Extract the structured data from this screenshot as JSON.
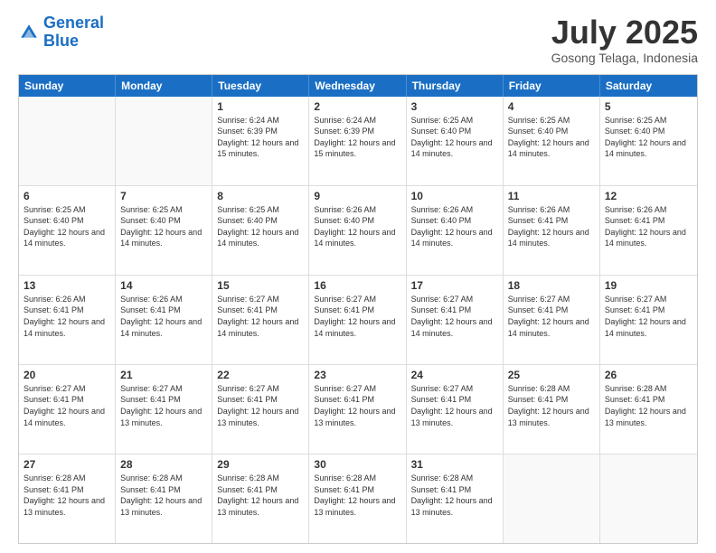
{
  "logo": {
    "text_general": "General",
    "text_blue": "Blue"
  },
  "title": "July 2025",
  "location": "Gosong Telaga, Indonesia",
  "header_days": [
    "Sunday",
    "Monday",
    "Tuesday",
    "Wednesday",
    "Thursday",
    "Friday",
    "Saturday"
  ],
  "weeks": [
    [
      {
        "day": "",
        "detail": ""
      },
      {
        "day": "",
        "detail": ""
      },
      {
        "day": "1",
        "detail": "Sunrise: 6:24 AM\nSunset: 6:39 PM\nDaylight: 12 hours and 15 minutes."
      },
      {
        "day": "2",
        "detail": "Sunrise: 6:24 AM\nSunset: 6:39 PM\nDaylight: 12 hours and 15 minutes."
      },
      {
        "day": "3",
        "detail": "Sunrise: 6:25 AM\nSunset: 6:40 PM\nDaylight: 12 hours and 14 minutes."
      },
      {
        "day": "4",
        "detail": "Sunrise: 6:25 AM\nSunset: 6:40 PM\nDaylight: 12 hours and 14 minutes."
      },
      {
        "day": "5",
        "detail": "Sunrise: 6:25 AM\nSunset: 6:40 PM\nDaylight: 12 hours and 14 minutes."
      }
    ],
    [
      {
        "day": "6",
        "detail": "Sunrise: 6:25 AM\nSunset: 6:40 PM\nDaylight: 12 hours and 14 minutes."
      },
      {
        "day": "7",
        "detail": "Sunrise: 6:25 AM\nSunset: 6:40 PM\nDaylight: 12 hours and 14 minutes."
      },
      {
        "day": "8",
        "detail": "Sunrise: 6:25 AM\nSunset: 6:40 PM\nDaylight: 12 hours and 14 minutes."
      },
      {
        "day": "9",
        "detail": "Sunrise: 6:26 AM\nSunset: 6:40 PM\nDaylight: 12 hours and 14 minutes."
      },
      {
        "day": "10",
        "detail": "Sunrise: 6:26 AM\nSunset: 6:40 PM\nDaylight: 12 hours and 14 minutes."
      },
      {
        "day": "11",
        "detail": "Sunrise: 6:26 AM\nSunset: 6:41 PM\nDaylight: 12 hours and 14 minutes."
      },
      {
        "day": "12",
        "detail": "Sunrise: 6:26 AM\nSunset: 6:41 PM\nDaylight: 12 hours and 14 minutes."
      }
    ],
    [
      {
        "day": "13",
        "detail": "Sunrise: 6:26 AM\nSunset: 6:41 PM\nDaylight: 12 hours and 14 minutes."
      },
      {
        "day": "14",
        "detail": "Sunrise: 6:26 AM\nSunset: 6:41 PM\nDaylight: 12 hours and 14 minutes."
      },
      {
        "day": "15",
        "detail": "Sunrise: 6:27 AM\nSunset: 6:41 PM\nDaylight: 12 hours and 14 minutes."
      },
      {
        "day": "16",
        "detail": "Sunrise: 6:27 AM\nSunset: 6:41 PM\nDaylight: 12 hours and 14 minutes."
      },
      {
        "day": "17",
        "detail": "Sunrise: 6:27 AM\nSunset: 6:41 PM\nDaylight: 12 hours and 14 minutes."
      },
      {
        "day": "18",
        "detail": "Sunrise: 6:27 AM\nSunset: 6:41 PM\nDaylight: 12 hours and 14 minutes."
      },
      {
        "day": "19",
        "detail": "Sunrise: 6:27 AM\nSunset: 6:41 PM\nDaylight: 12 hours and 14 minutes."
      }
    ],
    [
      {
        "day": "20",
        "detail": "Sunrise: 6:27 AM\nSunset: 6:41 PM\nDaylight: 12 hours and 14 minutes."
      },
      {
        "day": "21",
        "detail": "Sunrise: 6:27 AM\nSunset: 6:41 PM\nDaylight: 12 hours and 13 minutes."
      },
      {
        "day": "22",
        "detail": "Sunrise: 6:27 AM\nSunset: 6:41 PM\nDaylight: 12 hours and 13 minutes."
      },
      {
        "day": "23",
        "detail": "Sunrise: 6:27 AM\nSunset: 6:41 PM\nDaylight: 12 hours and 13 minutes."
      },
      {
        "day": "24",
        "detail": "Sunrise: 6:27 AM\nSunset: 6:41 PM\nDaylight: 12 hours and 13 minutes."
      },
      {
        "day": "25",
        "detail": "Sunrise: 6:28 AM\nSunset: 6:41 PM\nDaylight: 12 hours and 13 minutes."
      },
      {
        "day": "26",
        "detail": "Sunrise: 6:28 AM\nSunset: 6:41 PM\nDaylight: 12 hours and 13 minutes."
      }
    ],
    [
      {
        "day": "27",
        "detail": "Sunrise: 6:28 AM\nSunset: 6:41 PM\nDaylight: 12 hours and 13 minutes."
      },
      {
        "day": "28",
        "detail": "Sunrise: 6:28 AM\nSunset: 6:41 PM\nDaylight: 12 hours and 13 minutes."
      },
      {
        "day": "29",
        "detail": "Sunrise: 6:28 AM\nSunset: 6:41 PM\nDaylight: 12 hours and 13 minutes."
      },
      {
        "day": "30",
        "detail": "Sunrise: 6:28 AM\nSunset: 6:41 PM\nDaylight: 12 hours and 13 minutes."
      },
      {
        "day": "31",
        "detail": "Sunrise: 6:28 AM\nSunset: 6:41 PM\nDaylight: 12 hours and 13 minutes."
      },
      {
        "day": "",
        "detail": ""
      },
      {
        "day": "",
        "detail": ""
      }
    ]
  ]
}
